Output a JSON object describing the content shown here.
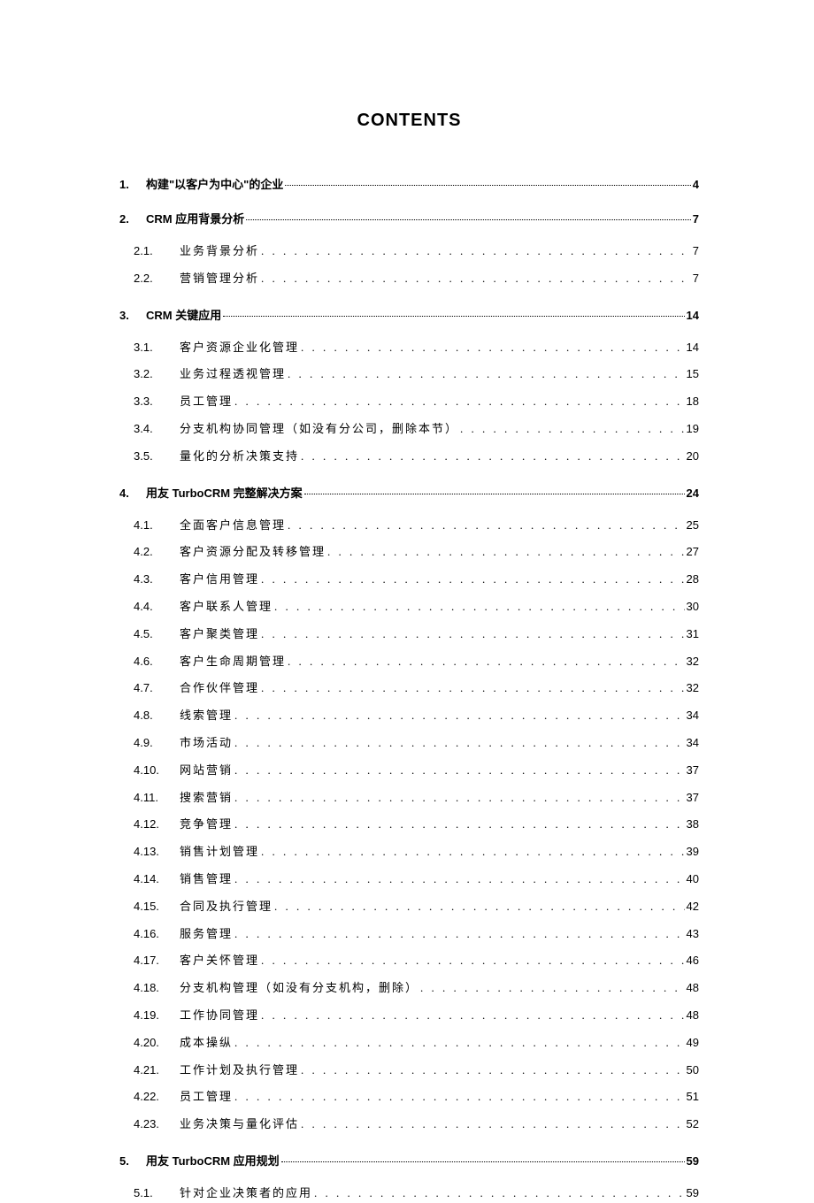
{
  "heading": "CONTENTS",
  "toc": [
    {
      "level": 1,
      "num": "1.",
      "title": "构建\"以客户为中心\"的企业",
      "page": "4"
    },
    {
      "level": 1,
      "num": "2.",
      "title": "CRM 应用背景分析",
      "page": "7"
    },
    {
      "level": 2,
      "num": "2.1.",
      "title": "业务背景分析",
      "page": "7"
    },
    {
      "level": 2,
      "num": "2.2.",
      "title": "营销管理分析",
      "page": "7"
    },
    {
      "level": 1,
      "num": "3.",
      "title": "CRM 关键应用",
      "page": "14"
    },
    {
      "level": 2,
      "num": "3.1.",
      "title": "客户资源企业化管理",
      "page": "14"
    },
    {
      "level": 2,
      "num": "3.2.",
      "title": "业务过程透视管理",
      "page": "15"
    },
    {
      "level": 2,
      "num": "3.3.",
      "title": "员工管理",
      "page": "18"
    },
    {
      "level": 2,
      "num": "3.4.",
      "title": "分支机构协同管理（如没有分公司，删除本节）",
      "page": "19"
    },
    {
      "level": 2,
      "num": "3.5.",
      "title": "量化的分析决策支持",
      "page": "20"
    },
    {
      "level": 1,
      "num": "4.",
      "title": "用友 TurboCRM 完整解决方案",
      "page": "24"
    },
    {
      "level": 2,
      "num": "4.1.",
      "title": "全面客户信息管理",
      "page": "25"
    },
    {
      "level": 2,
      "num": "4.2.",
      "title": "客户资源分配及转移管理",
      "page": "27"
    },
    {
      "level": 2,
      "num": "4.3.",
      "title": "客户信用管理",
      "page": "28"
    },
    {
      "level": 2,
      "num": "4.4.",
      "title": "客户联系人管理",
      "page": "30"
    },
    {
      "level": 2,
      "num": "4.5.",
      "title": "客户聚类管理",
      "page": "31"
    },
    {
      "level": 2,
      "num": "4.6.",
      "title": "客户生命周期管理",
      "page": "32"
    },
    {
      "level": 2,
      "num": "4.7.",
      "title": "合作伙伴管理",
      "page": "32"
    },
    {
      "level": 2,
      "num": "4.8.",
      "title": "线索管理",
      "page": "34"
    },
    {
      "level": 2,
      "num": "4.9.",
      "title": "市场活动",
      "page": "34"
    },
    {
      "level": 2,
      "num": "4.10.",
      "title": "网站营销",
      "page": "37"
    },
    {
      "level": 2,
      "num": "4.11.",
      "title": "搜索营销",
      "page": "37"
    },
    {
      "level": 2,
      "num": "4.12.",
      "title": "竞争管理",
      "page": "38"
    },
    {
      "level": 2,
      "num": "4.13.",
      "title": "销售计划管理",
      "page": "39"
    },
    {
      "level": 2,
      "num": "4.14.",
      "title": "销售管理",
      "page": "40"
    },
    {
      "level": 2,
      "num": "4.15.",
      "title": "合同及执行管理",
      "page": "42"
    },
    {
      "level": 2,
      "num": "4.16.",
      "title": "服务管理",
      "page": "43"
    },
    {
      "level": 2,
      "num": "4.17.",
      "title": "客户关怀管理",
      "page": "46"
    },
    {
      "level": 2,
      "num": "4.18.",
      "title": "分支机构管理（如没有分支机构，删除）",
      "page": "48"
    },
    {
      "level": 2,
      "num": "4.19.",
      "title": "工作协同管理",
      "page": "48"
    },
    {
      "level": 2,
      "num": "4.20.",
      "title": "成本操纵",
      "page": "49"
    },
    {
      "level": 2,
      "num": "4.21.",
      "title": "工作计划及执行管理",
      "page": "50"
    },
    {
      "level": 2,
      "num": "4.22.",
      "title": "员工管理",
      "page": "51"
    },
    {
      "level": 2,
      "num": "4.23.",
      "title": "业务决策与量化评估",
      "page": "52"
    },
    {
      "level": 1,
      "num": "5.",
      "title": "用友 TurboCRM 应用规划",
      "page": "59"
    },
    {
      "level": 2,
      "num": "5.1.",
      "title": "针对企业决策者的应用",
      "page": "59"
    }
  ]
}
